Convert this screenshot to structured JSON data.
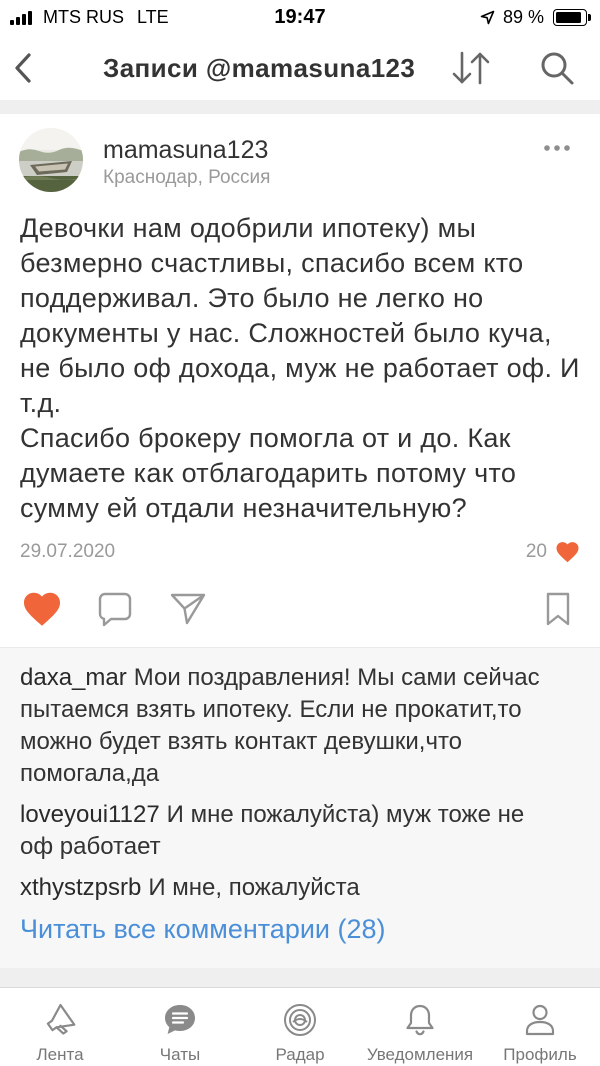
{
  "status_bar": {
    "carrier": "MTS RUS",
    "network": "LTE",
    "time": "19:47",
    "battery_text": "89 %",
    "battery_level": 0.89,
    "icons": [
      "signal-icon",
      "location-icon",
      "battery-icon"
    ]
  },
  "nav": {
    "title": "Записи @mamasuna123",
    "back_icon": "chevron-left-icon",
    "sort_icon": "sort-icon",
    "search_icon": "search-icon"
  },
  "post": {
    "author": "mamasuna123",
    "location": "Краснодар, Россия",
    "more_icon": "more-icon",
    "text_lines": [
      "Девочки нам одобрили ипотеку) мы",
      "безмерно счастливы, спасибо всем кто",
      "поддерживал. Это было не легко но",
      "документы у нас. Сложностей было куча,",
      "не было оф дохода, муж не работает оф. И",
      "т.д.",
      "Спасибо брокеру помогла от и до. Как",
      "думаете как отблагодарить потому что",
      "сумму ей отдали незначительную?"
    ],
    "date": "29.07.2020",
    "likes_count": "20",
    "actions": {
      "like_icon": "heart-icon",
      "comment_icon": "comment-icon",
      "share_icon": "send-icon",
      "bookmark_icon": "bookmark-icon"
    }
  },
  "comments": [
    {
      "author": "daxa_mar",
      "lines": [
        "Мои поздравления! Мы сами сейчас",
        "пытаемся взять ипотеку. Если не прокатит,то",
        "можно будет взять контакт девушки,что",
        "помогала,да"
      ]
    },
    {
      "author": "loveyoui1127",
      "lines": [
        "И мне пожалуйста) муж тоже не",
        "оф работает"
      ]
    },
    {
      "author": "xthystzpsrb",
      "lines": [
        "И мне, пожалуйста"
      ]
    }
  ],
  "read_all_label": "Читать все комментарии (28)",
  "tabbar": {
    "items": [
      {
        "label": "Лента",
        "icon": "megaphone-icon"
      },
      {
        "label": "Чаты",
        "icon": "chat-icon"
      },
      {
        "label": "Радар",
        "icon": "radar-icon"
      },
      {
        "label": "Уведомления",
        "icon": "bell-icon"
      },
      {
        "label": "Профиль",
        "icon": "profile-icon"
      }
    ]
  },
  "colors": {
    "accent": "#f0663a",
    "link": "#4a8fd8",
    "text": "#333333",
    "muted": "#9a9a9a",
    "icon": "#8a8a8a",
    "page_background": "#efefef",
    "comments_background": "#f7f7f7"
  }
}
